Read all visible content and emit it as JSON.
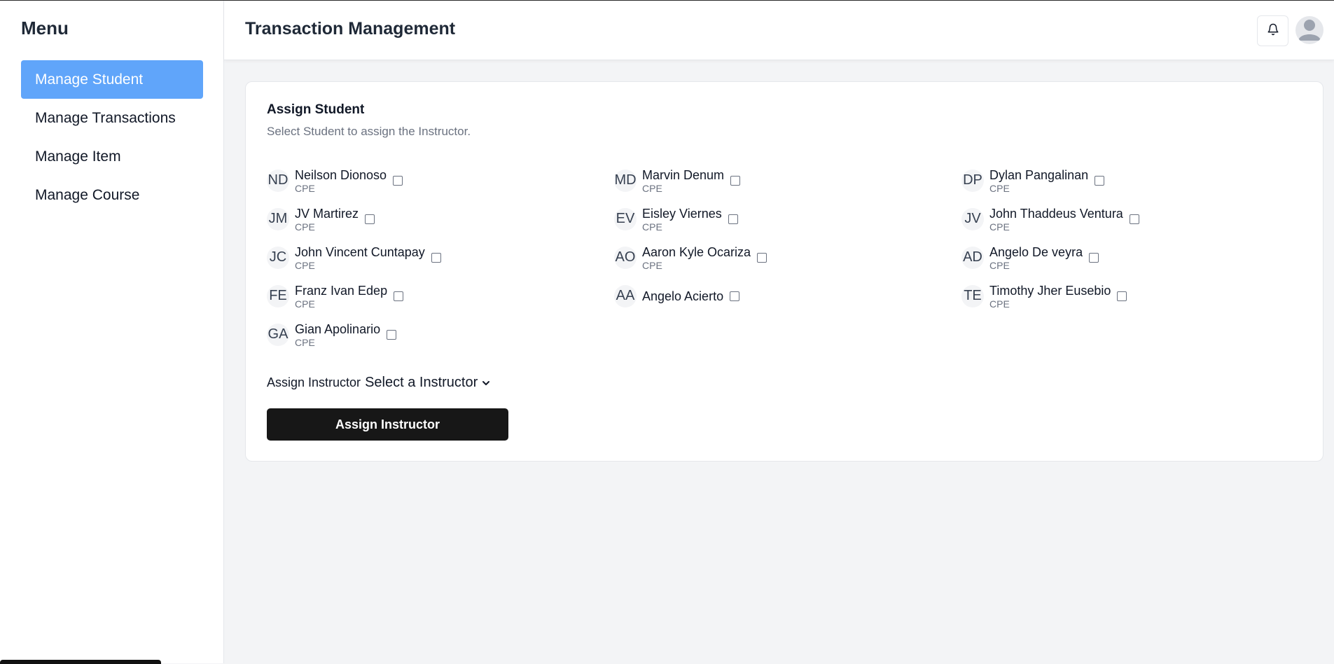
{
  "sidebar": {
    "title": "Menu",
    "items": [
      {
        "label": "Manage Student",
        "active": true
      },
      {
        "label": "Manage Transactions",
        "active": false
      },
      {
        "label": "Manage Item",
        "active": false
      },
      {
        "label": "Manage Course",
        "active": false
      }
    ]
  },
  "header": {
    "title": "Transaction Management",
    "icons": [
      "bell-icon",
      "user-avatar-icon"
    ]
  },
  "card": {
    "title": "Assign Student",
    "subtitle": "Select Student to assign the Instructor.",
    "students": [
      {
        "initials": "ND",
        "name": "Neilson Dionoso",
        "course": "CPE"
      },
      {
        "initials": "MD",
        "name": "Marvin Denum",
        "course": "CPE"
      },
      {
        "initials": "DP",
        "name": "Dylan Pangalinan",
        "course": "CPE"
      },
      {
        "initials": "JM",
        "name": "JV Martirez",
        "course": "CPE"
      },
      {
        "initials": "EV",
        "name": "Eisley Viernes",
        "course": "CPE"
      },
      {
        "initials": "JV",
        "name": "John Thaddeus Ventura",
        "course": "CPE"
      },
      {
        "initials": "JC",
        "name": "John Vincent Cuntapay",
        "course": "CPE"
      },
      {
        "initials": "AO",
        "name": "Aaron Kyle Ocariza",
        "course": "CPE"
      },
      {
        "initials": "AD",
        "name": "Angelo De veyra",
        "course": "CPE"
      },
      {
        "initials": "FE",
        "name": "Franz Ivan Edep",
        "course": "CPE"
      },
      {
        "initials": "AA",
        "name": "Angelo Acierto",
        "course": ""
      },
      {
        "initials": "TE",
        "name": "Timothy Jher Eusebio",
        "course": "CPE"
      },
      {
        "initials": "GA",
        "name": "Gian Apolinario",
        "course": "CPE"
      }
    ],
    "assign_label": "Assign Instructor",
    "instructor_select": "Select a Instructor",
    "assign_button": "Assign Instructor"
  },
  "colors": {
    "active_nav": "#60a5fa",
    "button_bg": "#171717",
    "background": "#f3f4f6"
  }
}
